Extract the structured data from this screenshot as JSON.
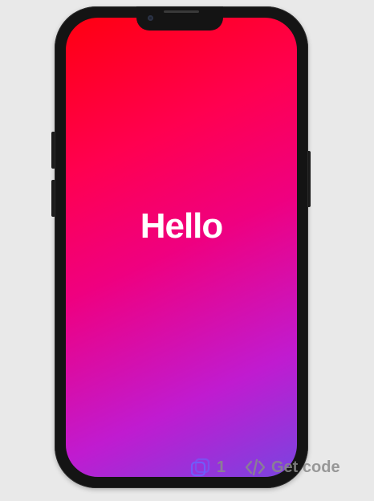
{
  "screen": {
    "greeting": "Hello",
    "gradient_colors": [
      "#ff0010",
      "#ff0050",
      "#ef0080",
      "#c01bd0",
      "#7a44e0"
    ]
  },
  "toolbar": {
    "copies_icon": "layers-icon",
    "copies_count": "1",
    "code_icon": "code-icon",
    "code_label": "Get code"
  }
}
